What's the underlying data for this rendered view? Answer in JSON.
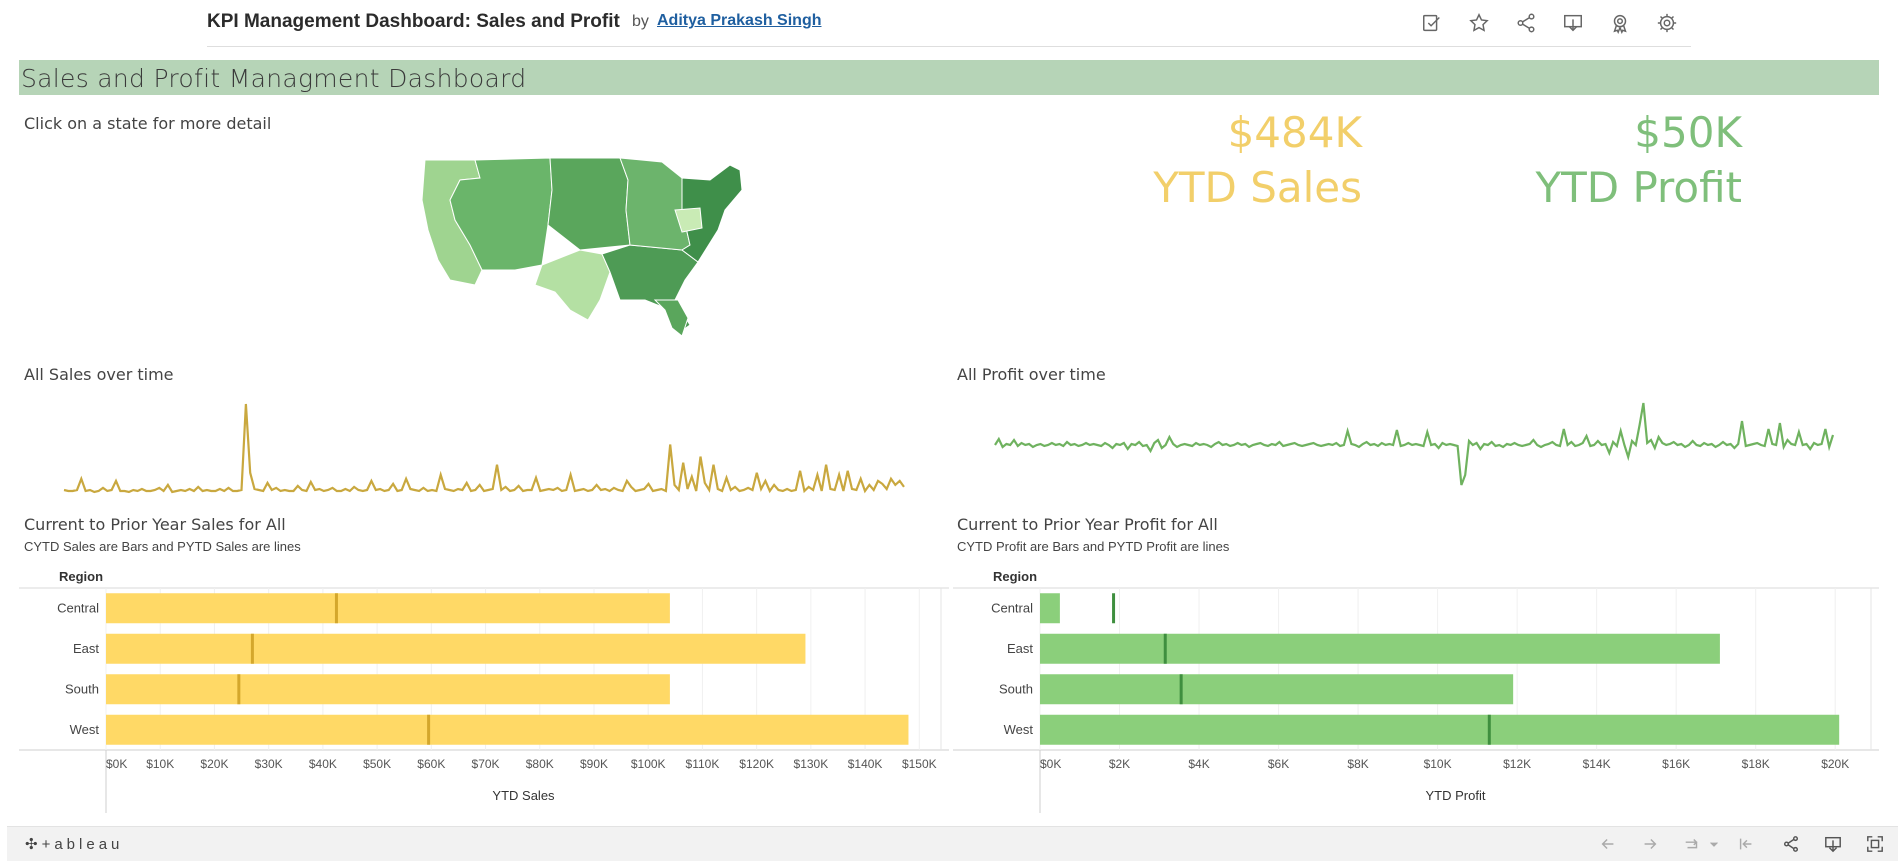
{
  "header": {
    "title": "KPI Management Dashboard: Sales and Profit",
    "by": "by",
    "author": "Aditya Prakash Singh",
    "icons": [
      "edit-icon",
      "favorite-star-icon",
      "share-icon",
      "download-icon",
      "badge-icon",
      "settings-gear-icon"
    ]
  },
  "dashboard": {
    "banner_title": "Sales and Profit Managment Dashboard",
    "map_hint": "Click on a state for more detail",
    "kpi": {
      "sales_value": "$484K",
      "sales_label": "YTD Sales",
      "profit_value": "$50K",
      "profit_label": "YTD Profit",
      "sales_color": "#f2cf6a",
      "profit_color": "#7fbf7b"
    },
    "sales_over_time_title": "All Sales over time",
    "profit_over_time_title": "All Profit over time",
    "sales_compare_title": "Current to Prior Year Sales for All",
    "sales_compare_sub": "CYTD Sales are Bars and PYTD Sales are lines",
    "profit_compare_title": "Current to Prior Year Profit for All",
    "profit_compare_sub": "CYTD Profit are Bars and PYTD Profit are lines",
    "region_header": "Region"
  },
  "chart_data": [
    {
      "type": "line",
      "title": "All Sales over time",
      "color": "#c9a83f",
      "values": [
        3,
        2,
        2,
        3,
        14,
        2,
        3,
        1,
        2,
        5,
        2,
        3,
        12,
        2,
        2,
        1,
        3,
        2,
        4,
        2,
        2,
        3,
        5,
        2,
        8,
        1,
        2,
        3,
        2,
        4,
        2,
        6,
        2,
        3,
        2,
        2,
        4,
        2,
        5,
        2,
        2,
        3,
        88,
        20,
        4,
        3,
        2,
        10,
        3,
        5,
        2,
        3,
        2,
        2,
        7,
        3,
        2,
        11,
        3,
        4,
        2,
        3,
        5,
        2,
        2,
        4,
        2,
        6,
        3,
        2,
        3,
        12,
        3,
        4,
        2,
        3,
        9,
        2,
        3,
        14,
        4,
        3,
        2,
        5,
        2,
        3,
        2,
        18,
        4,
        3,
        2,
        4,
        3,
        10,
        2,
        3,
        8,
        2,
        3,
        4,
        28,
        3,
        6,
        2,
        3,
        7,
        2,
        3,
        3,
        15,
        2,
        3,
        4,
        3,
        5,
        2,
        3,
        18,
        2,
        3,
        4,
        2,
        3,
        8,
        3,
        4,
        2,
        5,
        3,
        2,
        12,
        6,
        2,
        3,
        4,
        9,
        2,
        3,
        4,
        2,
        48,
        8,
        3,
        30,
        4,
        16,
        2,
        36,
        10,
        3,
        28,
        4,
        2,
        15,
        3,
        6,
        2,
        3,
        5,
        3,
        20,
        4,
        12,
        2,
        8,
        3,
        2,
        4,
        2,
        3,
        22,
        2,
        6,
        3,
        18,
        2,
        28,
        4,
        3,
        18,
        2,
        22,
        4,
        3,
        14,
        2,
        8,
        3,
        12,
        9,
        4,
        14,
        8,
        12,
        6
      ],
      "ylim": [
        0,
        92
      ]
    },
    {
      "type": "line",
      "title": "All Profit over time",
      "color": "#6fb25f",
      "values": [
        0,
        6,
        -2,
        1,
        0,
        5,
        -1,
        2,
        0,
        1,
        -2,
        0,
        1,
        -1,
        0,
        2,
        0,
        1,
        -1,
        3,
        0,
        1,
        -1,
        0,
        2,
        0,
        1,
        0,
        -1,
        2,
        0,
        -3,
        1,
        0,
        2,
        -4,
        1,
        0,
        3,
        -1,
        0,
        -6,
        2,
        5,
        -3,
        0,
        8,
        1,
        -2,
        0,
        1,
        0,
        -1,
        2,
        0,
        1,
        0,
        -2,
        1,
        3,
        0,
        1,
        -1,
        0,
        2,
        0,
        1,
        -2,
        0,
        1,
        2,
        0,
        -1,
        1,
        0,
        3,
        -1,
        0,
        1,
        2,
        0,
        -1,
        0,
        1,
        2,
        0,
        -1,
        0,
        1,
        0,
        2,
        -1,
        0,
        14,
        1,
        0,
        -2,
        1,
        3,
        0,
        1,
        -1,
        2,
        0,
        1,
        0,
        15,
        -1,
        0,
        2,
        0,
        1,
        0,
        -1,
        13,
        0,
        1,
        -3,
        2,
        0,
        1,
        0,
        -1,
        -40,
        -30,
        4,
        0,
        2,
        -4,
        1,
        0,
        3,
        -1,
        0,
        -2,
        1,
        0,
        2,
        0,
        -1,
        0,
        1,
        5,
        0,
        -2,
        0,
        1,
        3,
        0,
        -1,
        16,
        0,
        3,
        -1,
        0,
        2,
        9,
        -1,
        0,
        4,
        0,
        1,
        -8,
        3,
        -1,
        14,
        0,
        -12,
        4,
        0,
        20,
        42,
        2,
        5,
        -3,
        8,
        2,
        0,
        1,
        3,
        0,
        1,
        -2,
        0,
        4,
        0,
        -1,
        2,
        0,
        1,
        -2,
        0,
        3,
        0,
        1,
        -3,
        1,
        24,
        -1,
        0,
        1,
        2,
        0,
        -1,
        16,
        1,
        0,
        22,
        -2,
        5,
        1,
        0,
        13,
        0,
        1,
        -4,
        2,
        0,
        1,
        16,
        -2,
        10
      ],
      "ylim": [
        -45,
        45
      ]
    },
    {
      "type": "bar",
      "title": "Current to Prior Year Sales for All",
      "categories": [
        "Central",
        "East",
        "South",
        "West"
      ],
      "series": [
        {
          "values": [
            104000,
            129000,
            104000,
            148000
          ]
        },
        {
          "values": [
            42500,
            27000,
            24500,
            59500
          ]
        }
      ],
      "xlabel": "YTD Sales",
      "ylabel": "Region",
      "xlim": [
        0,
        154000
      ],
      "ticks": [
        "$0K",
        "$10K",
        "$20K",
        "$30K",
        "$40K",
        "$50K",
        "$60K",
        "$70K",
        "$80K",
        "$90K",
        "$100K",
        "$110K",
        "$120K",
        "$130K",
        "$140K",
        "$150K"
      ],
      "bar_color": "#ffd966",
      "line_color": "#d4a72c"
    },
    {
      "type": "bar",
      "title": "Current to Prior Year Profit for All",
      "categories": [
        "Central",
        "East",
        "South",
        "West"
      ],
      "series": [
        {
          "values": [
            500,
            17100,
            11900,
            20100
          ]
        },
        {
          "values": [
            1850,
            3150,
            3550,
            11300
          ]
        }
      ],
      "xlabel": "YTD Profit",
      "ylabel": "Region",
      "xlim": [
        0,
        20900
      ],
      "ticks": [
        "$0K",
        "$2K",
        "$4K",
        "$6K",
        "$8K",
        "$10K",
        "$12K",
        "$14K",
        "$16K",
        "$18K",
        "$20K"
      ],
      "bar_color": "#8bcf7b",
      "line_color": "#3f8f3f"
    }
  ],
  "footer": {
    "brand": "+ableau",
    "icons": [
      "undo-icon",
      "redo-icon",
      "revert-icon",
      "dropdown-icon",
      "reset-icon",
      "share-icon",
      "download-icon",
      "fullscreen-icon"
    ]
  }
}
